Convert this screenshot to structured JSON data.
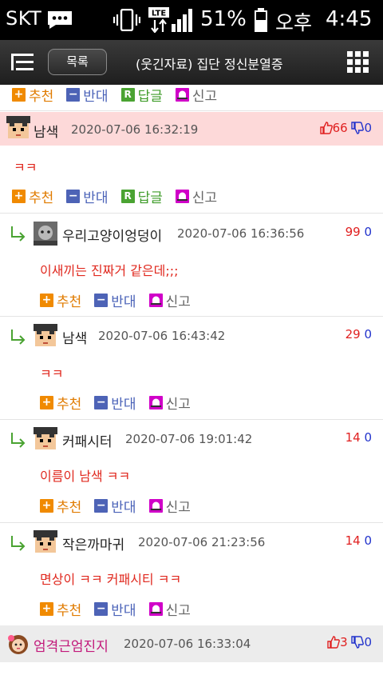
{
  "statusbar": {
    "carrier": "SKT",
    "network": "LTE",
    "battery": "51%",
    "ampm": "오후",
    "time": "4:45"
  },
  "nav": {
    "list_button": "목록",
    "title": "(웃긴자료) 집단 정신분열증"
  },
  "actions": {
    "recommend": "추천",
    "oppose": "반대",
    "reply": "답글",
    "report": "신고"
  },
  "comments": [
    {
      "nick": "남색",
      "date": "2020-07-06 16:32:19",
      "up": "66",
      "down": "0",
      "text": "ㅋㅋ"
    }
  ],
  "replies": [
    {
      "nick": "우리고양이엉덩이",
      "date": "2020-07-06 16:36:56",
      "up": "99",
      "down": "0",
      "text": "이새끼는 진짜거 같은데;;;"
    },
    {
      "nick": "남색",
      "date": "2020-07-06 16:43:42",
      "up": "29",
      "down": "0",
      "text": "ㅋㅋ"
    },
    {
      "nick": "커패시터",
      "date": "2020-07-06 19:01:42",
      "up": "14",
      "down": "0",
      "text": "이름이 남색 ㅋㅋ"
    },
    {
      "nick": "작은까마귀",
      "date": "2020-07-06 21:23:56",
      "up": "14",
      "down": "0",
      "text": "면상이 ㅋㅋ 커패시티 ㅋㅋ"
    }
  ],
  "last_comment": {
    "nick": "엄격근엄진지",
    "date": "2020-07-06 16:33:04",
    "up": "3",
    "down": "0"
  },
  "colors": {
    "highlight_row": "#fdd9d9",
    "comment_text": "#e0281e",
    "upvote": "#e02020",
    "downvote": "#2233cc"
  }
}
